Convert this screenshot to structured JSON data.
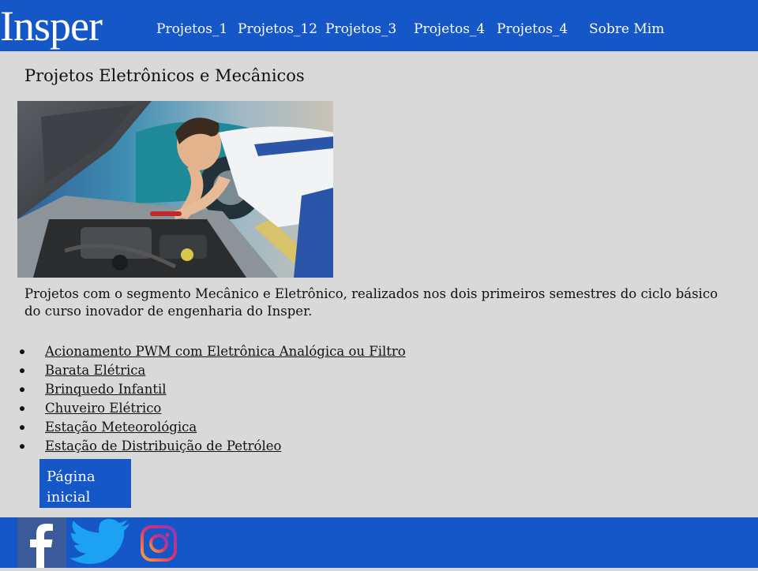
{
  "header": {
    "logo_text": "Insper",
    "nav": [
      {
        "label": "Projetos_1"
      },
      {
        "label": "Projetos_12"
      },
      {
        "label": "Projetos_3"
      },
      {
        "label": "Projetos_4"
      },
      {
        "label": "Projetos_4"
      },
      {
        "label": "Sobre Mim"
      }
    ]
  },
  "main": {
    "title": "Projetos Eletrônicos e Mecânicos",
    "description": "Projetos com o segmento  Mecânico e Eletrônico, realizados nos dois primeiros semestres do ciclo básico do curso inovador de engenharia do Insper.",
    "projects": [
      {
        "label": "Acionamento PWM com Eletrônica Analógica ou Filtro"
      },
      {
        "label": "Barata Elétrica"
      },
      {
        "label": "Brinquedo Infantil"
      },
      {
        "label": "Chuveiro Elétrico"
      },
      {
        "label": "Estação Meteorológica"
      },
      {
        "label": "Estação de Distribuição de Petróleo"
      }
    ],
    "home_button": "Página inicial"
  },
  "footer": {
    "icons": [
      "facebook-icon",
      "twitter-icon",
      "instagram-icon"
    ]
  },
  "colors": {
    "brand_blue": "#1557c7",
    "page_bg": "#d9d9d9"
  }
}
